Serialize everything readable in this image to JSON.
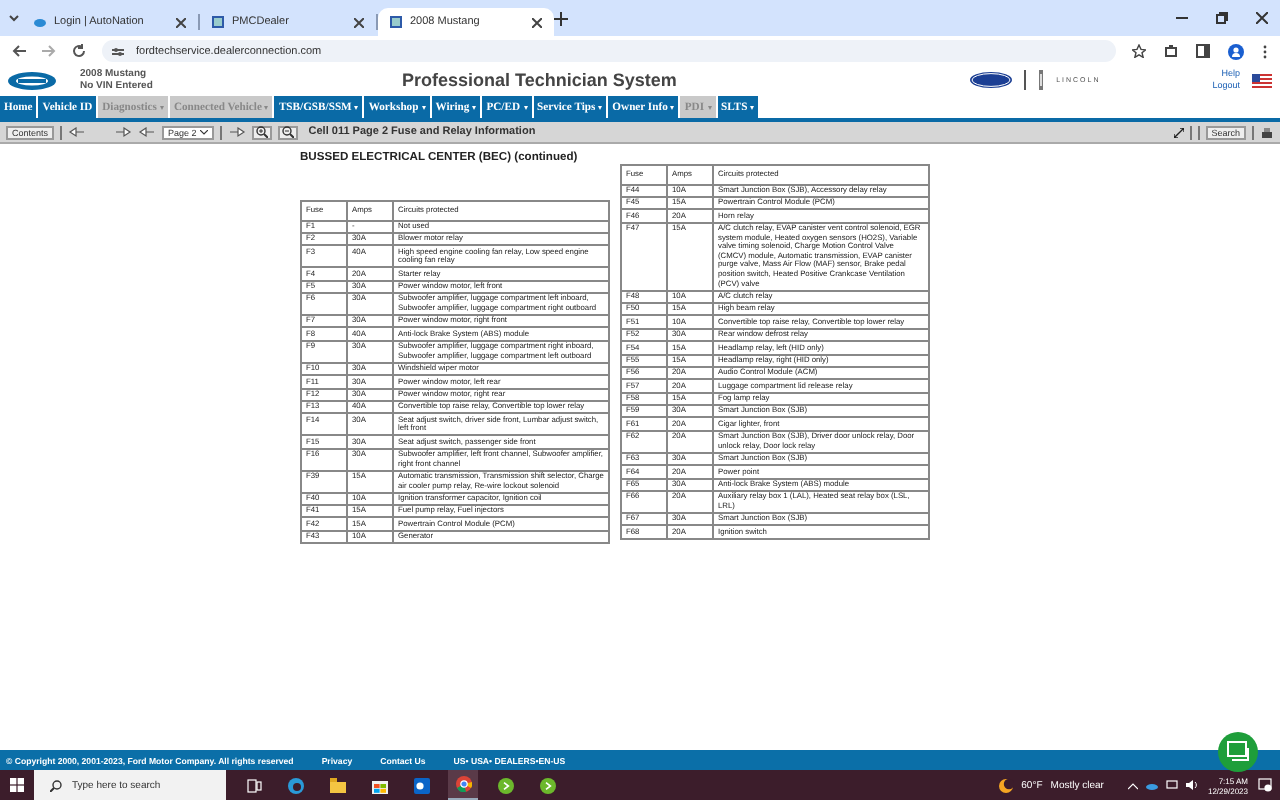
{
  "browser": {
    "tabs": [
      {
        "title": "Login | AutoNation",
        "selected": false
      },
      {
        "title": "PMCDealer",
        "selected": false
      },
      {
        "title": "2008 Mustang",
        "selected": true
      }
    ],
    "url": "fordtechservice.dealerconnection.com"
  },
  "header": {
    "vehicle": "2008 Mustang",
    "vin": "No VIN Entered",
    "title": "Professional Technician System",
    "brand_text": "LINCOLN",
    "help": "Help",
    "logout": "Logout"
  },
  "nav": [
    {
      "label": "Home",
      "menu": false,
      "disabled": false
    },
    {
      "label": "Vehicle ID",
      "menu": false,
      "disabled": false
    },
    {
      "label": "Diagnostics",
      "menu": true,
      "disabled": true
    },
    {
      "label": "Connected Vehicle",
      "menu": true,
      "disabled": true
    },
    {
      "label": "TSB/GSB/SSM",
      "menu": true,
      "disabled": false
    },
    {
      "label": "Workshop",
      "menu": true,
      "disabled": false
    },
    {
      "label": "Wiring",
      "menu": true,
      "disabled": false
    },
    {
      "label": "PC/ED",
      "menu": true,
      "disabled": false
    },
    {
      "label": "Service Tips",
      "menu": true,
      "disabled": false
    },
    {
      "label": "Owner Info",
      "menu": true,
      "disabled": false
    },
    {
      "label": "PDI",
      "menu": true,
      "disabled": true
    },
    {
      "label": "SLTS",
      "menu": true,
      "disabled": false
    }
  ],
  "toolbar": {
    "contents": "Contents",
    "page": "Page 2",
    "title": "Cell 011 Page 2 Fuse and Relay Information",
    "search": "Search"
  },
  "document": {
    "heading": "BUSSED ELECTRICAL CENTER (BEC) (continued)",
    "tables": [
      {
        "columns": [
          "Fuse",
          "Amps",
          "Circuits protected"
        ],
        "rows": [
          {
            "fuse": "F1",
            "amps": "-",
            "circuits": "Not used"
          },
          {
            "fuse": "F2",
            "amps": "30A",
            "circuits": "Blower motor relay"
          },
          {
            "fuse": "F3",
            "amps": "40A",
            "circuits": "High speed engine cooling fan relay, Low speed engine cooling fan relay"
          },
          {
            "fuse": "F4",
            "amps": "20A",
            "circuits": "Starter relay"
          },
          {
            "fuse": "F5",
            "amps": "30A",
            "circuits": "Power window motor, left front"
          },
          {
            "fuse": "F6",
            "amps": "30A",
            "circuits": "Subwoofer amplifier, luggage compartment left inboard, Subwoofer amplifier, luggage compartment right outboard"
          },
          {
            "fuse": "F7",
            "amps": "30A",
            "circuits": "Power window motor, right front"
          },
          {
            "fuse": "F8",
            "amps": "40A",
            "circuits": "Anti-lock Brake System (ABS) module"
          },
          {
            "fuse": "F9",
            "amps": "30A",
            "circuits": "Subwoofer amplifier, luggage compartment right inboard, Subwoofer amplifier, luggage compartment left outboard"
          },
          {
            "fuse": "F10",
            "amps": "30A",
            "circuits": "Windshield wiper motor"
          },
          {
            "fuse": "F11",
            "amps": "30A",
            "circuits": "Power window motor, left rear"
          },
          {
            "fuse": "F12",
            "amps": "30A",
            "circuits": "Power window motor, right rear"
          },
          {
            "fuse": "F13",
            "amps": "40A",
            "circuits": "Convertible top raise relay, Convertible top lower relay"
          },
          {
            "fuse": "F14",
            "amps": "30A",
            "circuits": "Seat adjust switch, driver side front, Lumbar adjust switch, left front"
          },
          {
            "fuse": "F15",
            "amps": "30A",
            "circuits": "Seat adjust switch, passenger side front"
          },
          {
            "fuse": "F16",
            "amps": "30A",
            "circuits": "Subwoofer amplifier, left front channel, Subwoofer amplifier, right front channel"
          },
          {
            "fuse": "F39",
            "amps": "15A",
            "circuits": "Automatic transmission, Transmission shift selector, Charge air cooler pump relay, Re-wire lockout solenoid"
          },
          {
            "fuse": "F40",
            "amps": "10A",
            "circuits": "Ignition transformer capacitor, Ignition coil"
          },
          {
            "fuse": "F41",
            "amps": "15A",
            "circuits": "Fuel pump relay, Fuel injectors"
          },
          {
            "fuse": "F42",
            "amps": "15A",
            "circuits": "Powertrain Control Module (PCM)"
          },
          {
            "fuse": "F43",
            "amps": "10A",
            "circuits": "Generator"
          }
        ]
      },
      {
        "columns": [
          "Fuse",
          "Amps",
          "Circuits protected"
        ],
        "rows": [
          {
            "fuse": "F44",
            "amps": "10A",
            "circuits": "Smart Junction Box (SJB), Accessory delay relay"
          },
          {
            "fuse": "F45",
            "amps": "15A",
            "circuits": "Powertrain Control Module (PCM)"
          },
          {
            "fuse": "F46",
            "amps": "20A",
            "circuits": "Horn relay"
          },
          {
            "fuse": "F47",
            "amps": "15A",
            "circuits": "A/C clutch relay, EVAP canister vent control solenoid, EGR system module, Heated oxygen sensors (HO2S), Variable valve timing solenoid, Charge Motion Control Valve (CMCV) module, Automatic transmission, EVAP canister purge valve, Mass Air Flow (MAF) sensor, Brake pedal position switch, Heated Positive Crankcase Ventilation (PCV) valve"
          },
          {
            "fuse": "F48",
            "amps": "10A",
            "circuits": "A/C clutch relay"
          },
          {
            "fuse": "F50",
            "amps": "15A",
            "circuits": "High beam relay"
          },
          {
            "fuse": "F51",
            "amps": "10A",
            "circuits": "Convertible top raise relay, Convertible top lower relay"
          },
          {
            "fuse": "F52",
            "amps": "30A",
            "circuits": "Rear window defrost relay"
          },
          {
            "fuse": "F54",
            "amps": "15A",
            "circuits": "Headlamp relay, left (HID only)"
          },
          {
            "fuse": "F55",
            "amps": "15A",
            "circuits": "Headlamp relay, right (HID only)"
          },
          {
            "fuse": "F56",
            "amps": "20A",
            "circuits": "Audio Control Module (ACM)"
          },
          {
            "fuse": "F57",
            "amps": "20A",
            "circuits": "Luggage compartment lid release relay"
          },
          {
            "fuse": "F58",
            "amps": "15A",
            "circuits": "Fog lamp relay"
          },
          {
            "fuse": "F59",
            "amps": "30A",
            "circuits": "Smart Junction Box (SJB)"
          },
          {
            "fuse": "F61",
            "amps": "20A",
            "circuits": "Cigar lighter, front"
          },
          {
            "fuse": "F62",
            "amps": "20A",
            "circuits": "Smart Junction Box (SJB), Driver door unlock relay, Door unlock relay, Door lock relay"
          },
          {
            "fuse": "F63",
            "amps": "30A",
            "circuits": "Smart Junction Box (SJB)"
          },
          {
            "fuse": "F64",
            "amps": "20A",
            "circuits": "Power point"
          },
          {
            "fuse": "F65",
            "amps": "30A",
            "circuits": "Anti-lock Brake System (ABS) module"
          },
          {
            "fuse": "F66",
            "amps": "20A",
            "circuits": "Auxiliary relay box 1 (LAL), Heated seat relay box (LSL, LRL)"
          },
          {
            "fuse": "F67",
            "amps": "30A",
            "circuits": "Smart Junction Box (SJB)"
          },
          {
            "fuse": "F68",
            "amps": "20A",
            "circuits": "Ignition switch"
          }
        ]
      }
    ]
  },
  "footer": {
    "copyright": "© Copyright 2000, 2001-2023, Ford Motor Company. All rights reserved",
    "links": [
      "Privacy",
      "Contact Us",
      "US• USA• DEALERS•EN-US"
    ]
  },
  "taskbar": {
    "search_placeholder": "Type here to search",
    "temperature": "60°F",
    "weather": "Mostly clear",
    "time": "7:15 AM",
    "date": "12/29/2023"
  }
}
